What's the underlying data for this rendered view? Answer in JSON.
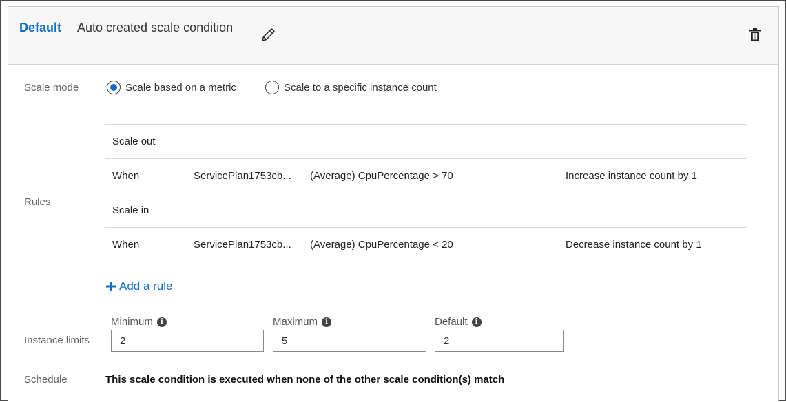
{
  "header": {
    "default_label": "Default",
    "condition_name": "Auto created scale condition",
    "edit_icon": "pencil-icon",
    "delete_icon": "trash-icon"
  },
  "scale_mode": {
    "label": "Scale mode",
    "options": [
      {
        "label": "Scale based on a metric",
        "selected": true
      },
      {
        "label": "Scale to a specific instance count",
        "selected": false
      }
    ]
  },
  "rules": {
    "label": "Rules",
    "scale_out": {
      "title": "Scale out",
      "rows": [
        {
          "when": "When",
          "resource": "ServicePlan1753cb...",
          "condition": "(Average) CpuPercentage > 70",
          "action": "Increase instance count by 1"
        }
      ]
    },
    "scale_in": {
      "title": "Scale in",
      "rows": [
        {
          "when": "When",
          "resource": "ServicePlan1753cb...",
          "condition": "(Average) CpuPercentage < 20",
          "action": "Decrease instance count by 1"
        }
      ]
    },
    "add_rule_label": "Add a rule"
  },
  "instance_limits": {
    "label": "Instance limits",
    "minimum": {
      "label": "Minimum",
      "value": "2"
    },
    "maximum": {
      "label": "Maximum",
      "value": "5"
    },
    "default": {
      "label": "Default",
      "value": "2"
    }
  },
  "schedule": {
    "label": "Schedule",
    "text": "This scale condition is executed when none of the other scale condition(s) match"
  },
  "colors": {
    "accent": "#106ebe",
    "header_bg": "#f7f7f7",
    "border": "#d9d9d9"
  }
}
